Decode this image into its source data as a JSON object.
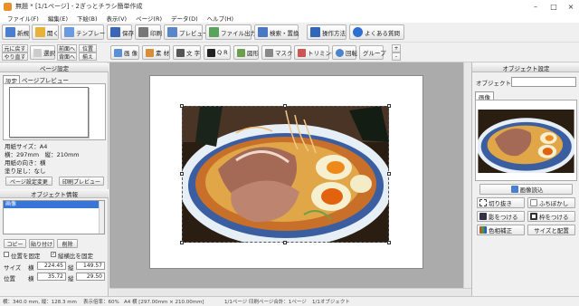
{
  "window": {
    "title": "無題 * [1/1ページ] - 2ぎっとチラシ簡単作成"
  },
  "menu": [
    "ファイル(F)",
    "編集(E)",
    "下絵(B)",
    "表示(V)",
    "ページ(R)",
    "データ(D)",
    "ヘルプ(H)"
  ],
  "toolbar1": {
    "new": "新規",
    "open": "開く",
    "template": "テンプレート",
    "save": "保存",
    "print": "印刷",
    "preview": "プレビュー",
    "export": "ファイル出力",
    "search": "検索・置換",
    "howto": "操作方法",
    "faq": "よくある質問"
  },
  "toolbar2": {
    "undo": "元に戻す",
    "redo": "やり直す",
    "select": "選択",
    "front": "前面へ",
    "back": "背面へ",
    "align1": "位置",
    "align2": "揃え",
    "image": "画 像",
    "material": "素 材",
    "text": "文 字",
    "qr": "Q R",
    "shape": "図形",
    "mask": "マスク",
    "trim": "トリミング",
    "rotate": "回転",
    "group": "グループ"
  },
  "page_settings": {
    "header": "ページ設定",
    "tab_settings": "設定",
    "tab_preview": "ページプレビュー",
    "paper_size": "用紙サイズ：A4",
    "dimensions": "横：297mm　縦：210mm",
    "orientation": "用紙の向き：横",
    "margin": "塗り足し：なし",
    "change_button": "ページ設定変更",
    "print_preview_button": "印刷プレビュー"
  },
  "object_info": {
    "header": "オブジェクト情報",
    "list_items": [
      "画像"
    ],
    "copy": "コピー",
    "paste": "貼り付け",
    "delete": "削除",
    "lock_position": "位置を固定",
    "lock_ratio": "縦横比を固定",
    "size_label": "サイズ",
    "pos_label": "位置",
    "w_label": "横",
    "h_label": "縦",
    "width": "224.45",
    "height": "149.57",
    "x": "35.72",
    "y": "29.50"
  },
  "object_settings": {
    "header": "オブジェクト設定",
    "name_label": "オブジェクト名",
    "name_value": "",
    "tab": "画像",
    "load_image": "画像読込",
    "crop": "切り抜き",
    "blur": "ふちぼかし",
    "shadow": "影をつける",
    "frame": "枠をつける",
    "color": "色相補正",
    "resize": "サイズと配置"
  },
  "status": {
    "cursor": "横：340.0 mm, 縦：128.3 mm",
    "zoom": "表示倍率：60%",
    "paper": "A4 横 [297.00mm × 210.00mm]",
    "pages": "1/1ページ 印刷ページ合計：1ページ",
    "objects": "1/1オブジェクト"
  }
}
